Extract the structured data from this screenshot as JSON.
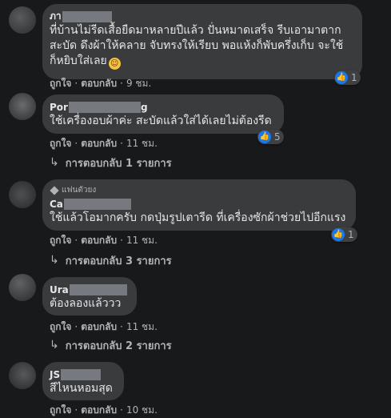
{
  "comments": [
    {
      "name": "ภา",
      "name_tail": "",
      "text_lines": [
        "ที่บ้านไม่รีดเสื้อยืดมาหลายปีแล้ว ปั่นหมาดเสร็จ รีบเอามาตาก",
        "สะบัด ดึงผ้าให้คลาย จับทรงให้เรียบ พอแห้งก็พับครึ่งเก็บ จะใช้",
        "ก็หยิบใส่เลย"
      ],
      "emoji": "grinning-sweat-emoji",
      "reaction_count": "1",
      "like": "ถูกใจ",
      "reply": "ตอบกลับ",
      "time": "9 ชม."
    },
    {
      "name": "Por",
      "name_tail": "g",
      "text_lines": [
        "ใช้เครื่องอบผ้าค่ะ สะบัดแล้วใส่ได้เลยไม่ต้องรีด"
      ],
      "reaction_count": "5",
      "like": "ถูกใจ",
      "reply": "ตอบกลับ",
      "time": "11 ชม.",
      "replies_label": "การตอบกลับ 1 รายการ"
    },
    {
      "badge": "แฟนตัวยง",
      "name": "Ca",
      "name_tail": "",
      "text_lines": [
        "ใช้แล้วโอมากครับ กดปุ่มรูปเตารีด ที่เครื่องซักผ้าช่วยไปอีกแรง"
      ],
      "reaction_count": "1",
      "like": "ถูกใจ",
      "reply": "ตอบกลับ",
      "time": "11 ชม.",
      "replies_label": "การตอบกลับ 3 รายการ"
    },
    {
      "name": "Ura",
      "name_tail": "",
      "text_lines": [
        "ต้องลองแล้ววว"
      ],
      "like": "ถูกใจ",
      "reply": "ตอบกลับ",
      "time": "11 ชม.",
      "replies_label": "การตอบกลับ 2 รายการ"
    },
    {
      "name": "JS",
      "name_tail": "",
      "text_lines": [
        "สีไหนหอมสุด"
      ],
      "like": "ถูกใจ",
      "reply": "ตอบกลับ",
      "time": "10 ชม."
    }
  ],
  "colors": {
    "background": "#18191a",
    "bubble": "#3a3b3c",
    "like": "#1877f2",
    "text": "#e4e6eb",
    "muted": "#b0b3b8"
  }
}
